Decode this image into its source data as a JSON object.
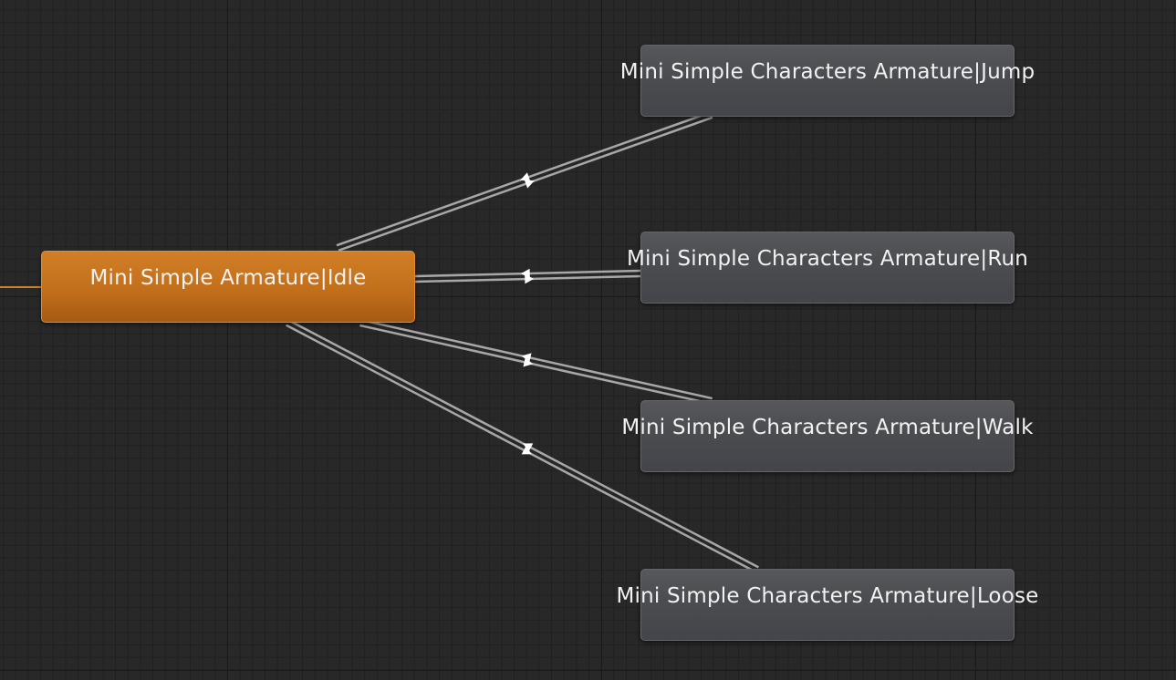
{
  "canvas": {
    "background_color": "#282828",
    "grid_color": "#1a1a1a"
  },
  "entry_connection": {
    "color": "#c9812c"
  },
  "states": {
    "idle": {
      "label": "Mini Simple Armature|Idle",
      "color": "#c97522",
      "is_default": true
    },
    "jump": {
      "label": "Mini Simple Characters Armature|Jump",
      "color": "#4b4d51"
    },
    "run": {
      "label": "Mini Simple Characters Armature|Run",
      "color": "#4b4d51"
    },
    "walk": {
      "label": "Mini Simple Characters Armature|Walk",
      "color": "#4b4d51"
    },
    "loose": {
      "label": "Mini Simple Characters Armature|Loose",
      "color": "#4b4d51"
    }
  },
  "transitions": [
    {
      "from": "idle",
      "to": "jump"
    },
    {
      "from": "jump",
      "to": "idle"
    },
    {
      "from": "idle",
      "to": "run"
    },
    {
      "from": "run",
      "to": "idle"
    },
    {
      "from": "idle",
      "to": "walk"
    },
    {
      "from": "walk",
      "to": "idle"
    },
    {
      "from": "idle",
      "to": "loose"
    },
    {
      "from": "loose",
      "to": "idle"
    }
  ],
  "transition_color": "#a7a7a7",
  "arrow_color": "#ffffff"
}
